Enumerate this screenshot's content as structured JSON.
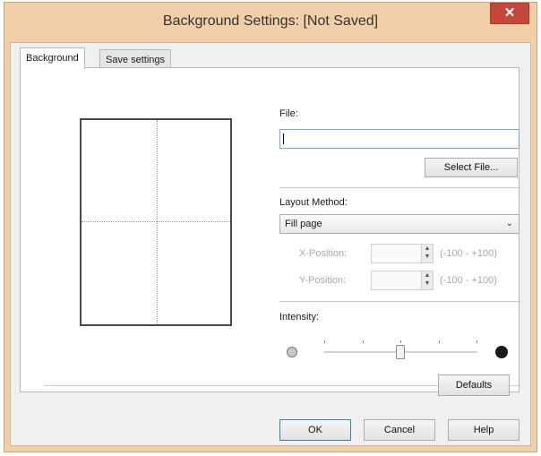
{
  "window": {
    "title": "Background Settings: [Not Saved]",
    "close_glyph": "✕"
  },
  "tabs": [
    {
      "label": "Background",
      "active": true
    },
    {
      "label": "Save settings",
      "active": false
    }
  ],
  "file": {
    "label": "File:",
    "value": "",
    "select_button": "Select File..."
  },
  "layout": {
    "label": "Layout Method:",
    "selected": "Fill page",
    "x_position": {
      "label": "X-Position:",
      "value": "",
      "range": "(-100 - +100)",
      "enabled": false
    },
    "y_position": {
      "label": "Y-Position:",
      "value": "",
      "range": "(-100 - +100)",
      "enabled": false
    }
  },
  "intensity": {
    "label": "Intensity:",
    "low_icon": "light-circle-icon",
    "high_icon": "dark-circle-icon",
    "level_fraction": 0.5
  },
  "buttons": {
    "defaults": "Defaults",
    "ok": "OK",
    "cancel": "Cancel",
    "help": "Help"
  },
  "colors": {
    "title_bar": "#f1cfa8",
    "close_button": "#c7463a",
    "input_focus_border": "#7aa7d8"
  }
}
